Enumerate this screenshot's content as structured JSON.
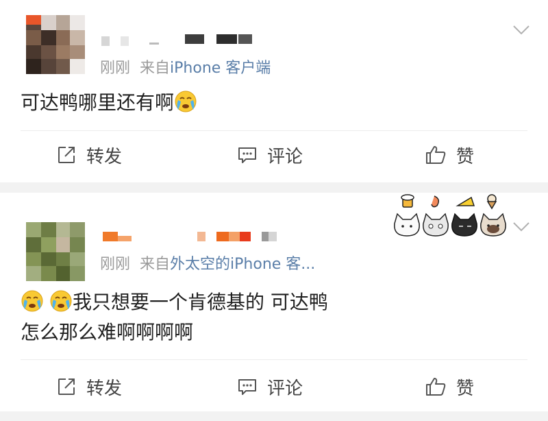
{
  "posts": [
    {
      "time": "刚刚",
      "source_prefix": "来自",
      "source": "iPhone 客户端",
      "content_lines": [
        "可达鸭哪里还有啊"
      ],
      "actions": {
        "repost": "转发",
        "comment": "评论",
        "like": "赞"
      }
    },
    {
      "time": "刚刚",
      "source_prefix": "来自",
      "source": "外太空的iPhone 客...",
      "content_lines": [
        "我只想要一个肯德基的 可达鸭",
        "怎么那么难啊啊啊啊"
      ],
      "actions": {
        "repost": "转发",
        "comment": "评论",
        "like": "赞"
      }
    }
  ],
  "colors": {
    "source_link": "#5a7ea8",
    "meta_gray": "#9a9a9a",
    "separator": "#f2f2f2"
  },
  "icons": [
    "repost-icon",
    "comment-icon",
    "like-icon",
    "chevron-down-icon",
    "crying-emoji-icon"
  ]
}
